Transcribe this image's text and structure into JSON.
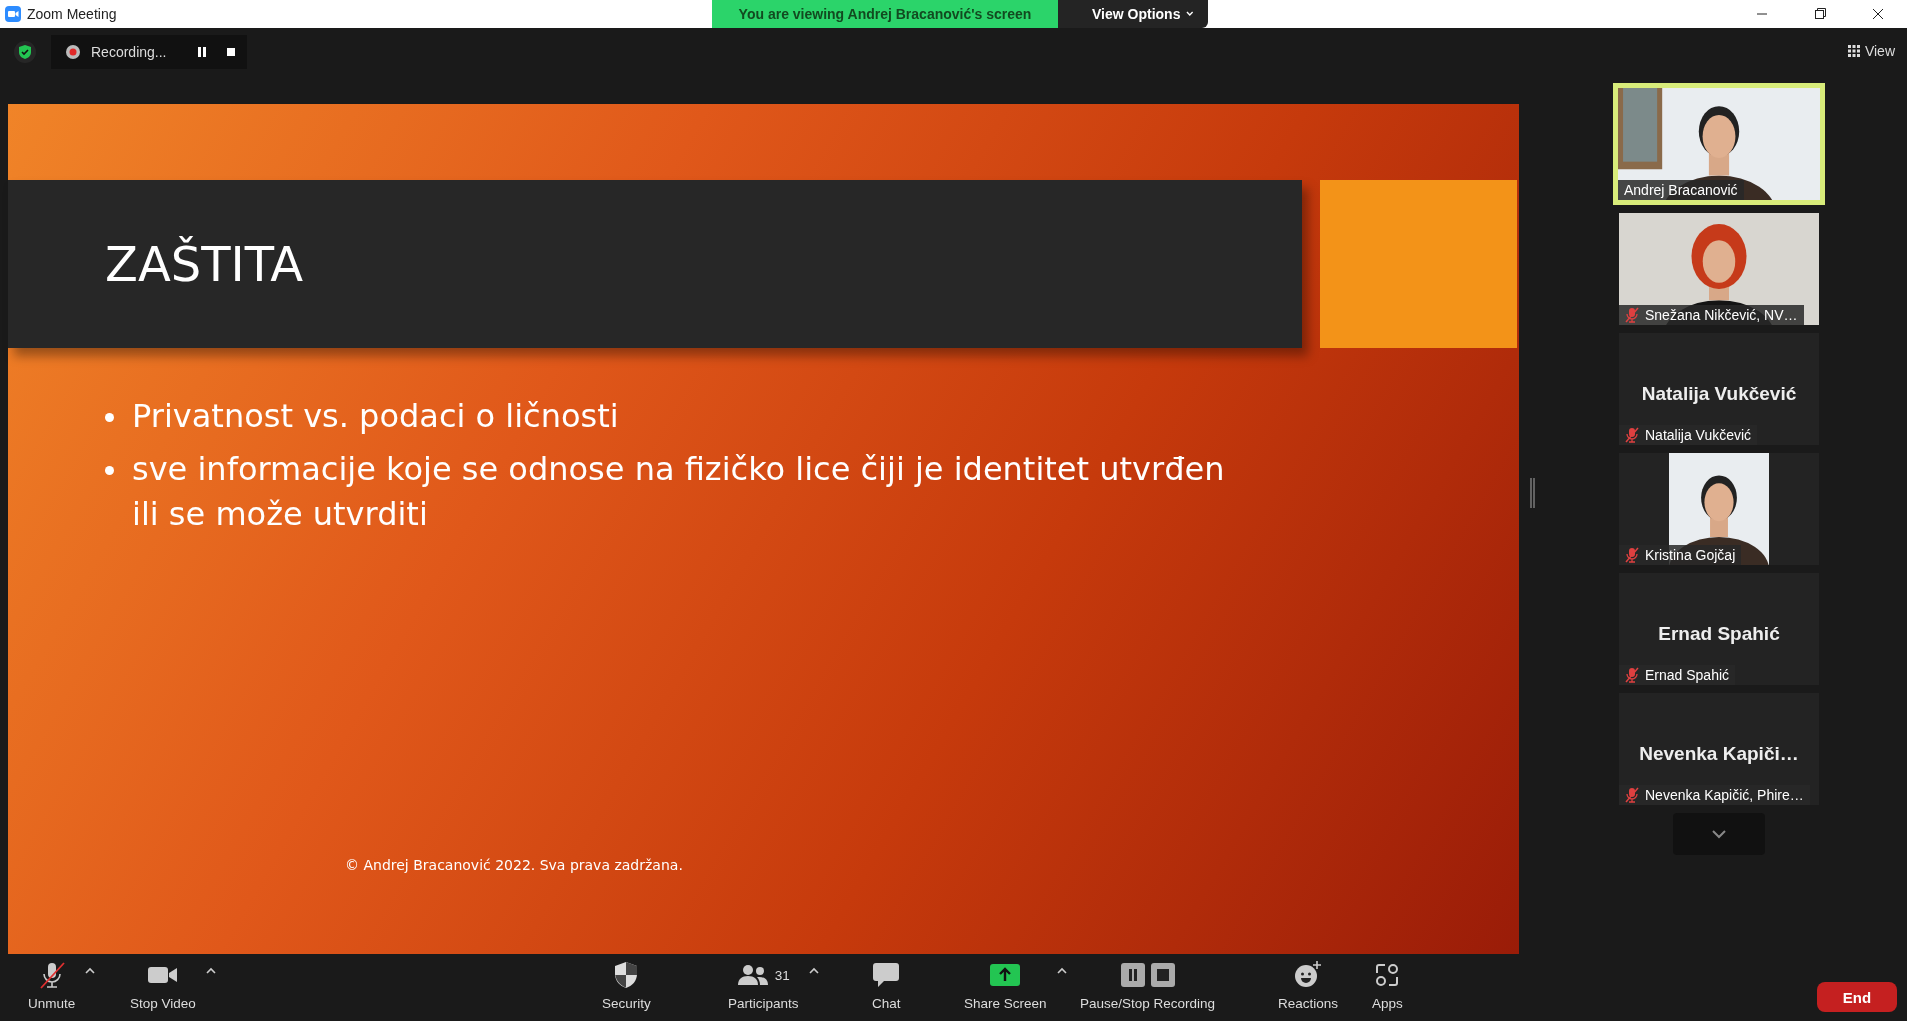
{
  "window": {
    "title": "Zoom Meeting"
  },
  "share_banner": {
    "text": "You are viewing Andrej Bracanović's screen",
    "options": "View Options"
  },
  "recording": {
    "label": "Recording..."
  },
  "view_button": {
    "label": "View"
  },
  "slide": {
    "title": "ZAŠTITA",
    "bullets": [
      "Privatnost vs. podaci o ličnosti",
      "sve informacije koje se odnose na fizičko lice čiji je identitet utvrđen ili se može utvrditi"
    ],
    "footer": "© Andrej Bracanović 2022. Sva prava zadržana."
  },
  "gallery": [
    {
      "kind": "video",
      "name": "Andrej Bracanović",
      "muted": false,
      "speaking": true
    },
    {
      "kind": "video",
      "name": "Snežana Nikčević, NV…",
      "muted": true,
      "speaking": false
    },
    {
      "kind": "name",
      "display_name": "Natalija Vukčević",
      "name": "Natalija Vukčević",
      "muted": true,
      "speaking": false
    },
    {
      "kind": "video",
      "name": "Kristina Gojčaj",
      "muted": true,
      "speaking": false
    },
    {
      "kind": "name",
      "display_name": "Ernad Spahić",
      "name": "Ernad Spahić",
      "muted": true,
      "speaking": false
    },
    {
      "kind": "name",
      "display_name": "Nevenka  Kapiči…",
      "name": "Nevenka Kapičić, Phire…",
      "muted": true,
      "speaking": false
    }
  ],
  "toolbar": [
    {
      "kind": "mic",
      "label": "Unmute",
      "caret": true
    },
    {
      "kind": "video",
      "label": "Stop Video",
      "caret": true
    },
    {
      "kind": "security",
      "label": "Security",
      "caret": false
    },
    {
      "kind": "participants",
      "label": "Participants",
      "count": "31",
      "caret": true
    },
    {
      "kind": "chat",
      "label": "Chat",
      "caret": false
    },
    {
      "kind": "share",
      "label": "Share Screen",
      "caret": true
    },
    {
      "kind": "recording",
      "label": "Pause/Stop Recording",
      "caret": false
    },
    {
      "kind": "reactions",
      "label": "Reactions",
      "caret": false
    },
    {
      "kind": "apps",
      "label": "Apps",
      "caret": false
    }
  ],
  "end_button": {
    "label": "End"
  }
}
